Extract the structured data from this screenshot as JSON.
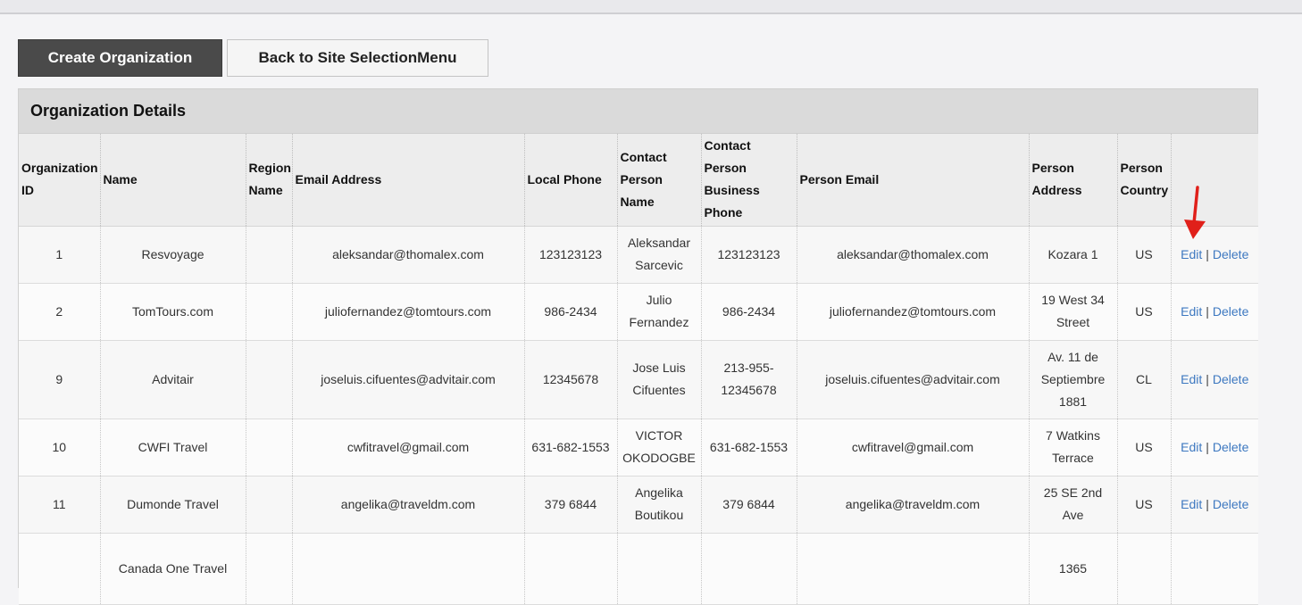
{
  "buttons": {
    "create": "Create Organization",
    "back": "Back to Site SelectionMenu"
  },
  "panel": {
    "title": "Organization Details"
  },
  "columns": [
    "Organization ID",
    "Name",
    "Region Name",
    "Email Address",
    "Local Phone",
    "Contact Person Name",
    "Contact Person Business Phone",
    "Person Email",
    "Person Address",
    "Person Country",
    ""
  ],
  "actions": {
    "edit": "Edit",
    "separator": "|",
    "delete": "Delete"
  },
  "rows": [
    {
      "id": "1",
      "name": "Resvoyage",
      "region": "",
      "email": "aleksandar@thomalex.com",
      "local_phone": "123123123",
      "contact_name": "Aleksandar Sarcevic",
      "contact_phone": "123123123",
      "person_email": "aleksandar@thomalex.com",
      "address": "Kozara 1",
      "country": "US"
    },
    {
      "id": "2",
      "name": "TomTours.com",
      "region": "",
      "email": "juliofernandez@tomtours.com",
      "local_phone": "986-2434",
      "contact_name": "Julio Fernandez",
      "contact_phone": "986-2434",
      "person_email": "juliofernandez@tomtours.com",
      "address": "19 West 34 Street",
      "country": "US"
    },
    {
      "id": "9",
      "name": "Advitair",
      "region": "",
      "email": "joseluis.cifuentes@advitair.com",
      "local_phone": "12345678",
      "contact_name": "Jose Luis Cifuentes",
      "contact_phone": "213-955-12345678",
      "person_email": "joseluis.cifuentes@advitair.com",
      "address": "Av. 11 de Septiembre 1881",
      "country": "CL"
    },
    {
      "id": "10",
      "name": "CWFI Travel",
      "region": "",
      "email": "cwfitravel@gmail.com",
      "local_phone": "631-682-1553",
      "contact_name": "VICTOR OKODOGBE",
      "contact_phone": "631-682-1553",
      "person_email": "cwfitravel@gmail.com",
      "address": "7 Watkins Terrace",
      "country": "US"
    },
    {
      "id": "11",
      "name": "Dumonde Travel",
      "region": "",
      "email": "angelika@traveldm.com",
      "local_phone": "379 6844",
      "contact_name": "Angelika Boutikou",
      "contact_phone": "379 6844",
      "person_email": "angelika@traveldm.com",
      "address": "25 SE 2nd Ave",
      "country": "US"
    },
    {
      "id": "",
      "name": "Canada One Travel",
      "region": "",
      "email": "",
      "local_phone": "",
      "contact_name": "",
      "contact_phone": "",
      "person_email": "",
      "address": "1365",
      "country": ""
    }
  ]
}
